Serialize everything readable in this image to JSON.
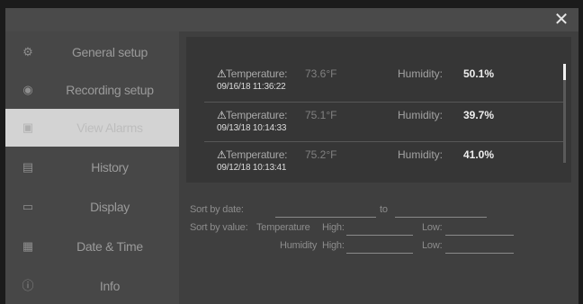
{
  "window": {
    "close_glyph": "✕"
  },
  "sidebar": {
    "items": [
      {
        "label": "General setup",
        "icon": "gear-icon",
        "glyph": "⚙",
        "active": false
      },
      {
        "label": "Recording setup",
        "icon": "record-icon",
        "glyph": "◉",
        "active": false
      },
      {
        "label": "View Alarms",
        "icon": "alarm-icon",
        "glyph": "▣",
        "active": true
      },
      {
        "label": "History",
        "icon": "history-icon",
        "glyph": "▤",
        "active": false
      },
      {
        "label": "Display",
        "icon": "monitor-icon",
        "glyph": "▭",
        "active": false
      },
      {
        "label": "Date & Time",
        "icon": "calendar-icon",
        "glyph": "▦",
        "active": false
      },
      {
        "label": "Info",
        "icon": "info-icon",
        "glyph": "ⓘ",
        "active": false
      }
    ]
  },
  "records": [
    {
      "icon": "alarm-bell-icon",
      "glyph": "⚠",
      "temp_label": "Temperature:",
      "temp_value": "73.6°F",
      "hum_label": "Humidity:",
      "hum_value": "50.1%",
      "date": "09/16/18 11:36:22"
    },
    {
      "icon": "alarm-bell-icon",
      "glyph": "⚠",
      "temp_label": "Temperature:",
      "temp_value": "75.1°F",
      "hum_label": "Humidity:",
      "hum_value": "39.7%",
      "date": "09/13/18 10:14:33"
    },
    {
      "icon": "alarm-bell-icon",
      "glyph": "⚠",
      "temp_label": "Temperature:",
      "temp_value": "75.2°F",
      "hum_label": "Humidity:",
      "hum_value": "41.0%",
      "date": "09/12/18 10:13:41"
    }
  ],
  "filters": {
    "sort_by_date_label": "Sort by date:",
    "to_label": "to",
    "sort_by_value_label": "Sort by value:",
    "temperature_label": "Temperature",
    "humidity_label": "Humidity",
    "high_label": "High:",
    "low_label": "Low:"
  },
  "colors": {
    "accent_active": "#d3d3d3",
    "background": "#3a3a3a"
  }
}
